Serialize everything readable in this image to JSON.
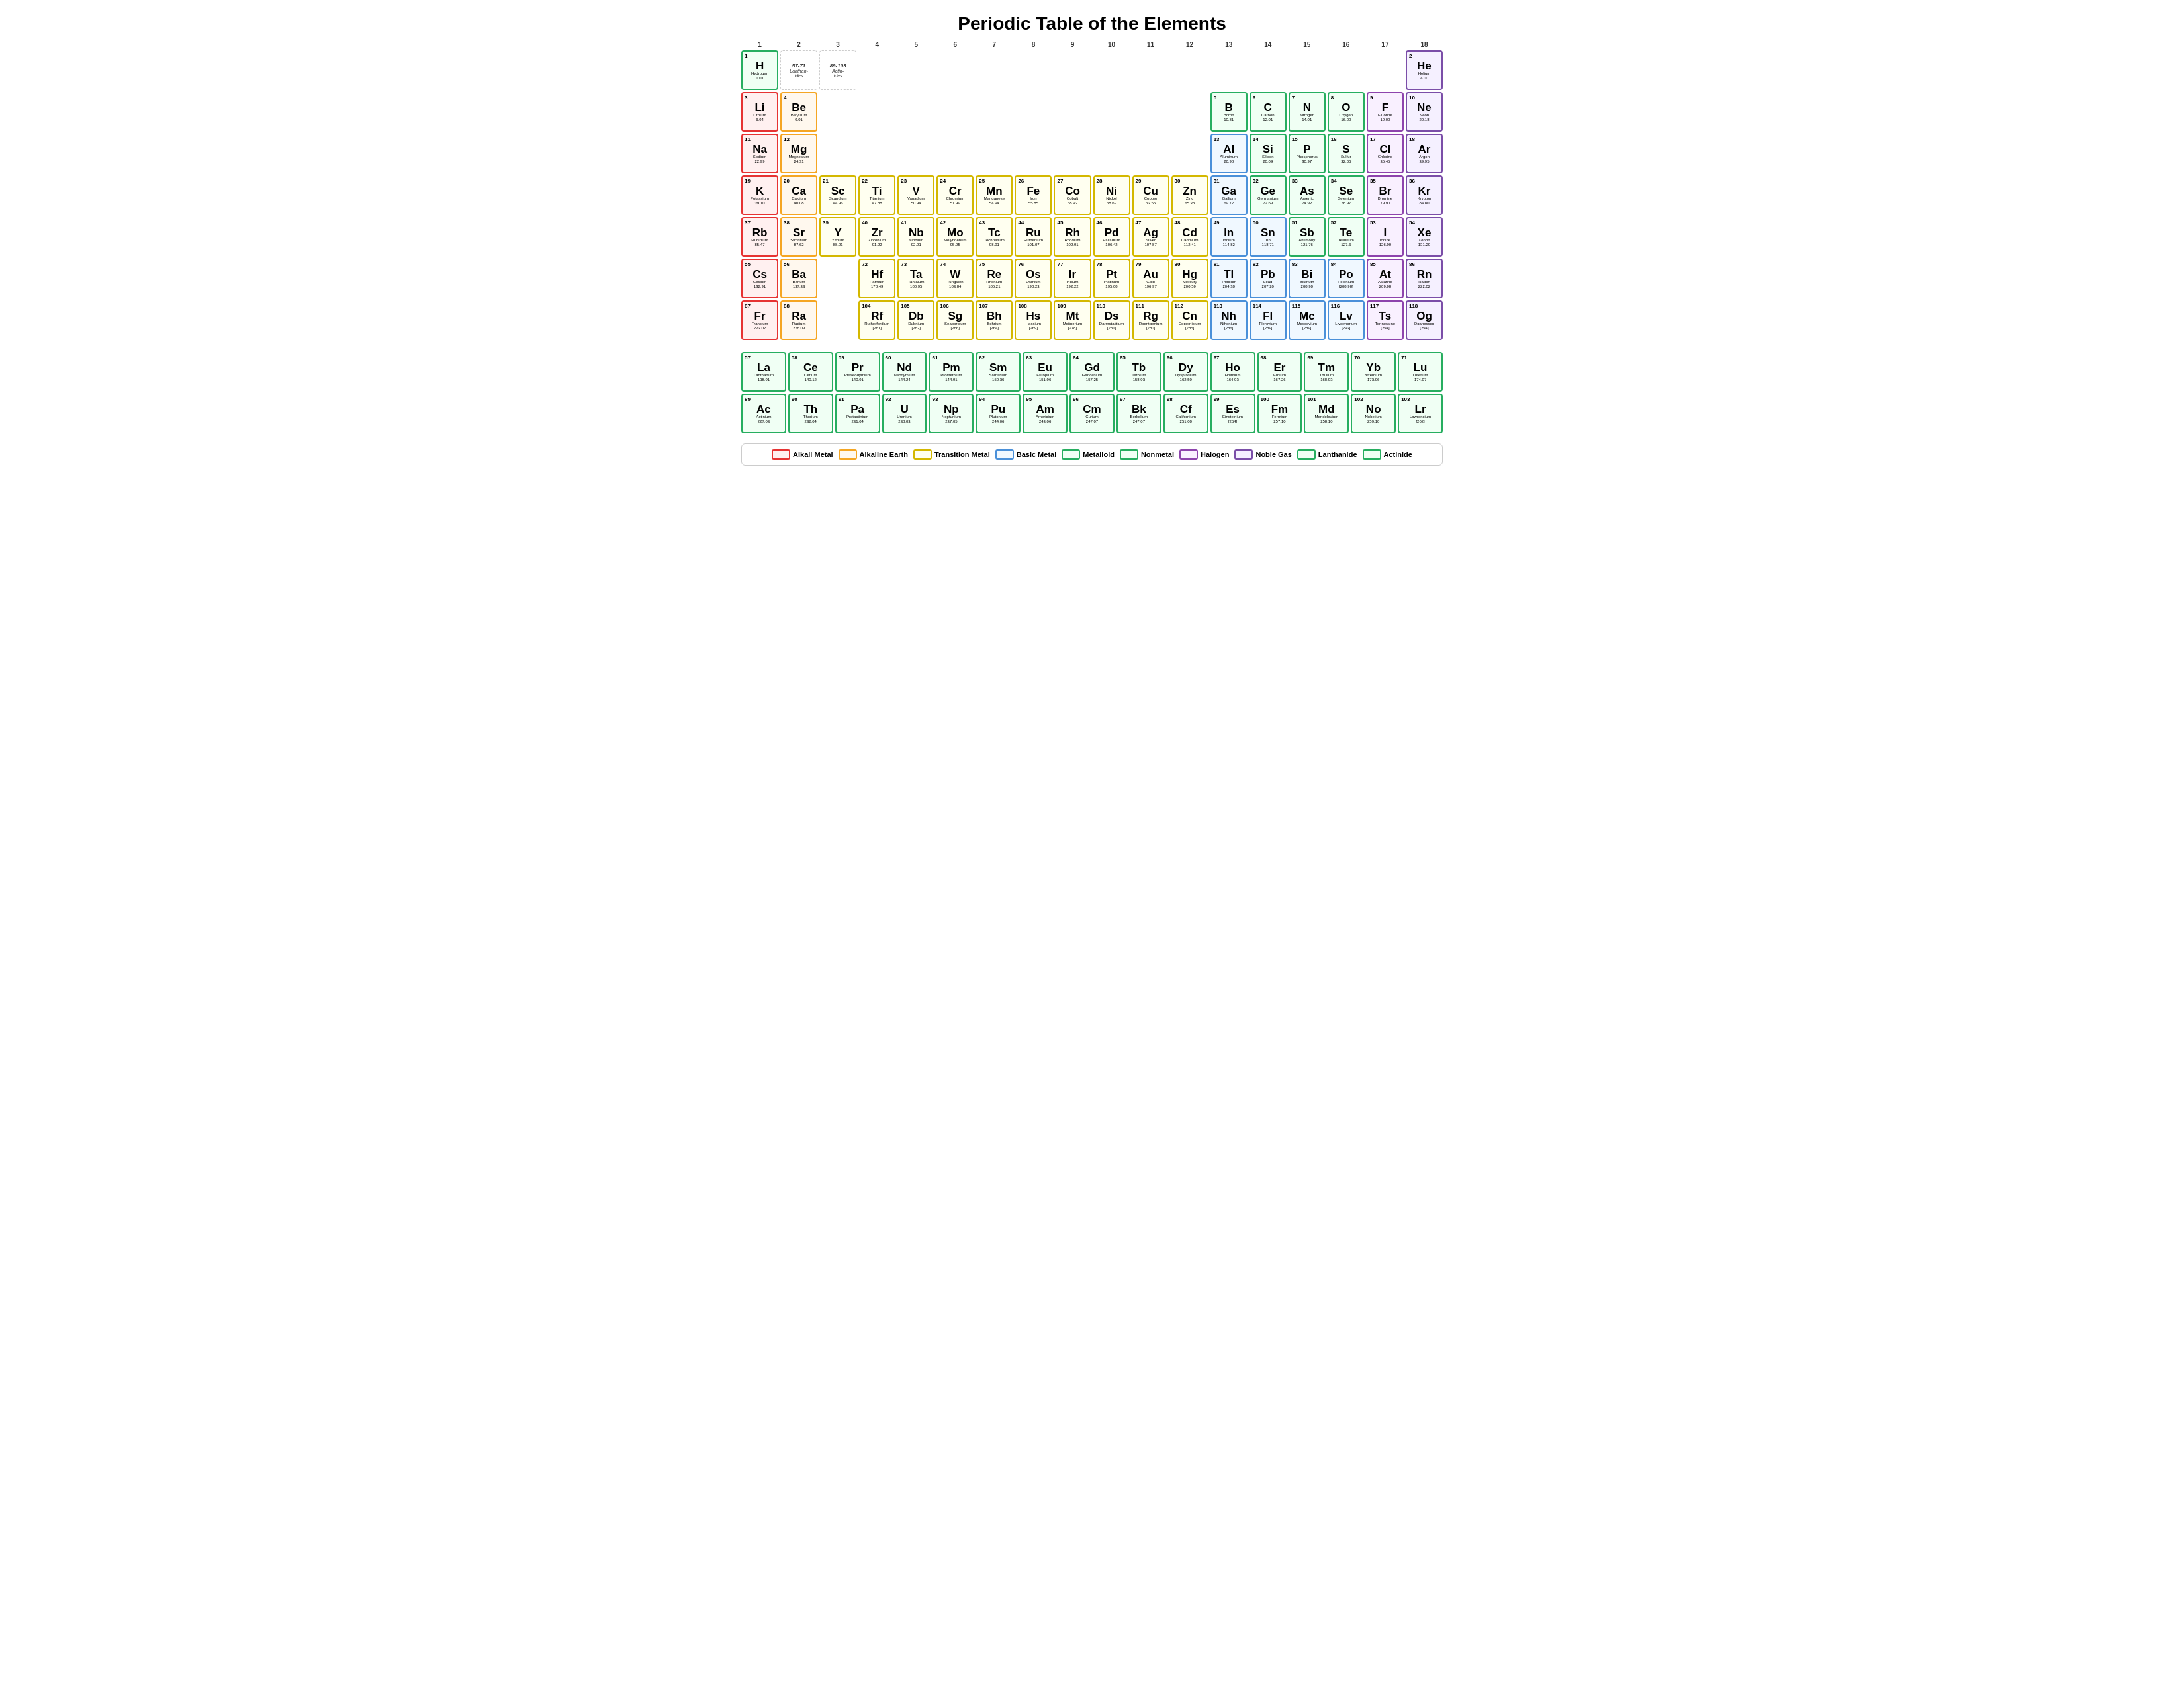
{
  "title": "Periodic Table of the Elements",
  "colHeaders": [
    1,
    2,
    3,
    4,
    5,
    6,
    7,
    8,
    9,
    10,
    11,
    12,
    13,
    14,
    15,
    16,
    17,
    18
  ],
  "legend": [
    {
      "label": "Alkali Metal",
      "class": "alkali",
      "borderColor": "#e63333",
      "bg": "#fff0f0"
    },
    {
      "label": "Alkaline Earth",
      "class": "alkaline",
      "borderColor": "#f5a623",
      "bg": "#fff8ee"
    },
    {
      "label": "Transition Metal",
      "class": "transition",
      "borderColor": "#e0b800",
      "bg": "#fffff0"
    },
    {
      "label": "Basic Metal",
      "class": "basic-metal",
      "borderColor": "#4a90d9",
      "bg": "#f0f8ff"
    },
    {
      "label": "Metalloid",
      "class": "metalloid",
      "borderColor": "#27ae60",
      "bg": "#f0fff4"
    },
    {
      "label": "Nonmetal",
      "class": "nonmetal",
      "borderColor": "#27ae60",
      "bg": "#f0fff4"
    },
    {
      "label": "Halogen",
      "class": "halogen",
      "borderColor": "#8e44ad",
      "bg": "#f9f0ff"
    },
    {
      "label": "Noble Gas",
      "class": "noble",
      "borderColor": "#7b4ea8",
      "bg": "#f5f0ff"
    },
    {
      "label": "Lanthanide",
      "class": "lanthanide",
      "borderColor": "#27ae60",
      "bg": "#f0fff4"
    },
    {
      "label": "Actinide",
      "class": "actinide",
      "borderColor": "#27ae60",
      "bg": "#f0fff4"
    }
  ],
  "elements": [
    {
      "num": 1,
      "sym": "H",
      "name": "Hydrogen",
      "mass": "1.01",
      "cat": "nonmetal",
      "col": 1,
      "row": 1
    },
    {
      "num": 2,
      "sym": "He",
      "name": "Helium",
      "mass": "4.00",
      "cat": "noble",
      "col": 18,
      "row": 1
    },
    {
      "num": 3,
      "sym": "Li",
      "name": "Lithium",
      "mass": "6.94",
      "cat": "alkali",
      "col": 1,
      "row": 2
    },
    {
      "num": 4,
      "sym": "Be",
      "name": "Beryllium",
      "mass": "9.01",
      "cat": "alkaline",
      "col": 2,
      "row": 2
    },
    {
      "num": 5,
      "sym": "B",
      "name": "Boron",
      "mass": "10.81",
      "cat": "metalloid",
      "col": 13,
      "row": 2
    },
    {
      "num": 6,
      "sym": "C",
      "name": "Carbon",
      "mass": "12.01",
      "cat": "nonmetal",
      "col": 14,
      "row": 2
    },
    {
      "num": 7,
      "sym": "N",
      "name": "Nitrogen",
      "mass": "14.01",
      "cat": "nonmetal",
      "col": 15,
      "row": 2
    },
    {
      "num": 8,
      "sym": "O",
      "name": "Oxygen",
      "mass": "16.00",
      "cat": "nonmetal",
      "col": 16,
      "row": 2
    },
    {
      "num": 9,
      "sym": "F",
      "name": "Fluorine",
      "mass": "19.00",
      "cat": "halogen",
      "col": 17,
      "row": 2
    },
    {
      "num": 10,
      "sym": "Ne",
      "name": "Neon",
      "mass": "20.18",
      "cat": "noble",
      "col": 18,
      "row": 2
    },
    {
      "num": 11,
      "sym": "Na",
      "name": "Sodium",
      "mass": "22.99",
      "cat": "alkali",
      "col": 1,
      "row": 3
    },
    {
      "num": 12,
      "sym": "Mg",
      "name": "Magnesium",
      "mass": "24.31",
      "cat": "alkaline",
      "col": 2,
      "row": 3
    },
    {
      "num": 13,
      "sym": "Al",
      "name": "Aluminum",
      "mass": "26.98",
      "cat": "basic-metal",
      "col": 13,
      "row": 3
    },
    {
      "num": 14,
      "sym": "Si",
      "name": "Silicon",
      "mass": "28.09",
      "cat": "metalloid",
      "col": 14,
      "row": 3
    },
    {
      "num": 15,
      "sym": "P",
      "name": "Phosphorus",
      "mass": "30.97",
      "cat": "nonmetal",
      "col": 15,
      "row": 3
    },
    {
      "num": 16,
      "sym": "S",
      "name": "Sulfur",
      "mass": "32.06",
      "cat": "nonmetal",
      "col": 16,
      "row": 3
    },
    {
      "num": 17,
      "sym": "Cl",
      "name": "Chlorine",
      "mass": "35.45",
      "cat": "halogen",
      "col": 17,
      "row": 3
    },
    {
      "num": 18,
      "sym": "Ar",
      "name": "Argon",
      "mass": "39.95",
      "cat": "noble",
      "col": 18,
      "row": 3
    },
    {
      "num": 19,
      "sym": "K",
      "name": "Potassium",
      "mass": "39.10",
      "cat": "alkali",
      "col": 1,
      "row": 4
    },
    {
      "num": 20,
      "sym": "Ca",
      "name": "Calcium",
      "mass": "40.08",
      "cat": "alkaline",
      "col": 2,
      "row": 4
    },
    {
      "num": 21,
      "sym": "Sc",
      "name": "Scandium",
      "mass": "44.96",
      "cat": "transition",
      "col": 3,
      "row": 4
    },
    {
      "num": 22,
      "sym": "Ti",
      "name": "Titanium",
      "mass": "47.88",
      "cat": "transition",
      "col": 4,
      "row": 4
    },
    {
      "num": 23,
      "sym": "V",
      "name": "Vanadium",
      "mass": "50.94",
      "cat": "transition",
      "col": 5,
      "row": 4
    },
    {
      "num": 24,
      "sym": "Cr",
      "name": "Chromium",
      "mass": "51.99",
      "cat": "transition",
      "col": 6,
      "row": 4
    },
    {
      "num": 25,
      "sym": "Mn",
      "name": "Manganese",
      "mass": "54.94",
      "cat": "transition",
      "col": 7,
      "row": 4
    },
    {
      "num": 26,
      "sym": "Fe",
      "name": "Iron",
      "mass": "55.85",
      "cat": "transition",
      "col": 8,
      "row": 4
    },
    {
      "num": 27,
      "sym": "Co",
      "name": "Cobalt",
      "mass": "58.93",
      "cat": "transition",
      "col": 9,
      "row": 4
    },
    {
      "num": 28,
      "sym": "Ni",
      "name": "Nickel",
      "mass": "58.69",
      "cat": "transition",
      "col": 10,
      "row": 4
    },
    {
      "num": 29,
      "sym": "Cu",
      "name": "Copper",
      "mass": "63.55",
      "cat": "transition",
      "col": 11,
      "row": 4
    },
    {
      "num": 30,
      "sym": "Zn",
      "name": "Zinc",
      "mass": "65.38",
      "cat": "transition",
      "col": 12,
      "row": 4
    },
    {
      "num": 31,
      "sym": "Ga",
      "name": "Gallium",
      "mass": "69.72",
      "cat": "basic-metal",
      "col": 13,
      "row": 4
    },
    {
      "num": 32,
      "sym": "Ge",
      "name": "Germanium",
      "mass": "72.63",
      "cat": "metalloid",
      "col": 14,
      "row": 4
    },
    {
      "num": 33,
      "sym": "As",
      "name": "Arsenic",
      "mass": "74.92",
      "cat": "metalloid",
      "col": 15,
      "row": 4
    },
    {
      "num": 34,
      "sym": "Se",
      "name": "Selenium",
      "mass": "78.97",
      "cat": "nonmetal",
      "col": 16,
      "row": 4
    },
    {
      "num": 35,
      "sym": "Br",
      "name": "Bromine",
      "mass": "79.90",
      "cat": "halogen",
      "col": 17,
      "row": 4
    },
    {
      "num": 36,
      "sym": "Kr",
      "name": "Krypton",
      "mass": "84.80",
      "cat": "noble",
      "col": 18,
      "row": 4
    },
    {
      "num": 37,
      "sym": "Rb",
      "name": "Rubidium",
      "mass": "85.47",
      "cat": "alkali",
      "col": 1,
      "row": 5
    },
    {
      "num": 38,
      "sym": "Sr",
      "name": "Strontium",
      "mass": "87.62",
      "cat": "alkaline",
      "col": 2,
      "row": 5
    },
    {
      "num": 39,
      "sym": "Y",
      "name": "Yttrium",
      "mass": "88.91",
      "cat": "transition",
      "col": 3,
      "row": 5
    },
    {
      "num": 40,
      "sym": "Zr",
      "name": "Zirconium",
      "mass": "91.22",
      "cat": "transition",
      "col": 4,
      "row": 5
    },
    {
      "num": 41,
      "sym": "Nb",
      "name": "Niobium",
      "mass": "92.91",
      "cat": "transition",
      "col": 5,
      "row": 5
    },
    {
      "num": 42,
      "sym": "Mo",
      "name": "Molybdenum",
      "mass": "95.95",
      "cat": "transition",
      "col": 6,
      "row": 5
    },
    {
      "num": 43,
      "sym": "Tc",
      "name": "Technetium",
      "mass": "98.91",
      "cat": "transition",
      "col": 7,
      "row": 5
    },
    {
      "num": 44,
      "sym": "Ru",
      "name": "Ruthenium",
      "mass": "101.07",
      "cat": "transition",
      "col": 8,
      "row": 5
    },
    {
      "num": 45,
      "sym": "Rh",
      "name": "Rhodium",
      "mass": "102.91",
      "cat": "transition",
      "col": 9,
      "row": 5
    },
    {
      "num": 46,
      "sym": "Pd",
      "name": "Palladium",
      "mass": "106.42",
      "cat": "transition",
      "col": 10,
      "row": 5
    },
    {
      "num": 47,
      "sym": "Ag",
      "name": "Silver",
      "mass": "107.87",
      "cat": "transition",
      "col": 11,
      "row": 5
    },
    {
      "num": 48,
      "sym": "Cd",
      "name": "Cadmium",
      "mass": "112.41",
      "cat": "transition",
      "col": 12,
      "row": 5
    },
    {
      "num": 49,
      "sym": "In",
      "name": "Indium",
      "mass": "114.82",
      "cat": "basic-metal",
      "col": 13,
      "row": 5
    },
    {
      "num": 50,
      "sym": "Sn",
      "name": "Tin",
      "mass": "118.71",
      "cat": "basic-metal",
      "col": 14,
      "row": 5
    },
    {
      "num": 51,
      "sym": "Sb",
      "name": "Antimony",
      "mass": "121.76",
      "cat": "metalloid",
      "col": 15,
      "row": 5
    },
    {
      "num": 52,
      "sym": "Te",
      "name": "Tellurium",
      "mass": "127.6",
      "cat": "metalloid",
      "col": 16,
      "row": 5
    },
    {
      "num": 53,
      "sym": "I",
      "name": "Iodine",
      "mass": "126.90",
      "cat": "halogen",
      "col": 17,
      "row": 5
    },
    {
      "num": 54,
      "sym": "Xe",
      "name": "Xenon",
      "mass": "131.29",
      "cat": "noble",
      "col": 18,
      "row": 5
    },
    {
      "num": 55,
      "sym": "Cs",
      "name": "Cesium",
      "mass": "132.91",
      "cat": "alkali",
      "col": 1,
      "row": 6
    },
    {
      "num": 56,
      "sym": "Ba",
      "name": "Barium",
      "mass": "137.33",
      "cat": "alkaline",
      "col": 2,
      "row": 6
    },
    {
      "num": 72,
      "sym": "Hf",
      "name": "Hafnium",
      "mass": "178.49",
      "cat": "transition",
      "col": 4,
      "row": 6
    },
    {
      "num": 73,
      "sym": "Ta",
      "name": "Tantalum",
      "mass": "180.95",
      "cat": "transition",
      "col": 5,
      "row": 6
    },
    {
      "num": 74,
      "sym": "W",
      "name": "Tungsten",
      "mass": "183.84",
      "cat": "transition",
      "col": 6,
      "row": 6
    },
    {
      "num": 75,
      "sym": "Re",
      "name": "Rhenium",
      "mass": "186.21",
      "cat": "transition",
      "col": 7,
      "row": 6
    },
    {
      "num": 76,
      "sym": "Os",
      "name": "Osmium",
      "mass": "190.23",
      "cat": "transition",
      "col": 8,
      "row": 6
    },
    {
      "num": 77,
      "sym": "Ir",
      "name": "Iridium",
      "mass": "192.22",
      "cat": "transition",
      "col": 9,
      "row": 6
    },
    {
      "num": 78,
      "sym": "Pt",
      "name": "Platinum",
      "mass": "195.08",
      "cat": "transition",
      "col": 10,
      "row": 6
    },
    {
      "num": 79,
      "sym": "Au",
      "name": "Gold",
      "mass": "196.97",
      "cat": "transition",
      "col": 11,
      "row": 6
    },
    {
      "num": 80,
      "sym": "Hg",
      "name": "Mercury",
      "mass": "200.59",
      "cat": "transition",
      "col": 12,
      "row": 6
    },
    {
      "num": 81,
      "sym": "Tl",
      "name": "Thallium",
      "mass": "204.38",
      "cat": "basic-metal",
      "col": 13,
      "row": 6
    },
    {
      "num": 82,
      "sym": "Pb",
      "name": "Lead",
      "mass": "207.20",
      "cat": "basic-metal",
      "col": 14,
      "row": 6
    },
    {
      "num": 83,
      "sym": "Bi",
      "name": "Bismuth",
      "mass": "208.98",
      "cat": "basic-metal",
      "col": 15,
      "row": 6
    },
    {
      "num": 84,
      "sym": "Po",
      "name": "Polonium",
      "mass": "[208.98]",
      "cat": "basic-metal",
      "col": 16,
      "row": 6
    },
    {
      "num": 85,
      "sym": "At",
      "name": "Astatine",
      "mass": "209.98",
      "cat": "halogen",
      "col": 17,
      "row": 6
    },
    {
      "num": 86,
      "sym": "Rn",
      "name": "Radon",
      "mass": "222.02",
      "cat": "noble",
      "col": 18,
      "row": 6
    },
    {
      "num": 87,
      "sym": "Fr",
      "name": "Francium",
      "mass": "223.02",
      "cat": "alkali",
      "col": 1,
      "row": 7
    },
    {
      "num": 88,
      "sym": "Ra",
      "name": "Radium",
      "mass": "226.03",
      "cat": "alkaline",
      "col": 2,
      "row": 7
    },
    {
      "num": 104,
      "sym": "Rf",
      "name": "Rutherfordium",
      "mass": "[261]",
      "cat": "transition",
      "col": 4,
      "row": 7
    },
    {
      "num": 105,
      "sym": "Db",
      "name": "Dubnium",
      "mass": "[262]",
      "cat": "transition",
      "col": 5,
      "row": 7
    },
    {
      "num": 106,
      "sym": "Sg",
      "name": "Seaborgium",
      "mass": "[266]",
      "cat": "transition",
      "col": 6,
      "row": 7
    },
    {
      "num": 107,
      "sym": "Bh",
      "name": "Bohrium",
      "mass": "[264]",
      "cat": "transition",
      "col": 7,
      "row": 7
    },
    {
      "num": 108,
      "sym": "Hs",
      "name": "Hassium",
      "mass": "[269]",
      "cat": "transition",
      "col": 8,
      "row": 7
    },
    {
      "num": 109,
      "sym": "Mt",
      "name": "Meitnerium",
      "mass": "[278]",
      "cat": "transition",
      "col": 9,
      "row": 7
    },
    {
      "num": 110,
      "sym": "Ds",
      "name": "Darmstadtium",
      "mass": "[281]",
      "cat": "transition",
      "col": 10,
      "row": 7
    },
    {
      "num": 111,
      "sym": "Rg",
      "name": "Roentgenium",
      "mass": "[280]",
      "cat": "transition",
      "col": 11,
      "row": 7
    },
    {
      "num": 112,
      "sym": "Cn",
      "name": "Copernicium",
      "mass": "[285]",
      "cat": "transition",
      "col": 12,
      "row": 7
    },
    {
      "num": 113,
      "sym": "Nh",
      "name": "Nihonium",
      "mass": "[286]",
      "cat": "basic-metal",
      "col": 13,
      "row": 7
    },
    {
      "num": 114,
      "sym": "Fl",
      "name": "Flerovium",
      "mass": "[289]",
      "cat": "basic-metal",
      "col": 14,
      "row": 7
    },
    {
      "num": 115,
      "sym": "Mc",
      "name": "Moscovium",
      "mass": "[289]",
      "cat": "basic-metal",
      "col": 15,
      "row": 7
    },
    {
      "num": 116,
      "sym": "Lv",
      "name": "Livermorium",
      "mass": "[293]",
      "cat": "basic-metal",
      "col": 16,
      "row": 7
    },
    {
      "num": 117,
      "sym": "Ts",
      "name": "Tennessine",
      "mass": "[294]",
      "cat": "halogen",
      "col": 17,
      "row": 7
    },
    {
      "num": 118,
      "sym": "Og",
      "name": "Oganesson",
      "mass": "[294]",
      "cat": "noble",
      "col": 18,
      "row": 7
    }
  ],
  "lanthanides": [
    {
      "num": 57,
      "sym": "La",
      "name": "Lanthanum",
      "mass": "138.91"
    },
    {
      "num": 58,
      "sym": "Ce",
      "name": "Cerium",
      "mass": "140.12"
    },
    {
      "num": 59,
      "sym": "Pr",
      "name": "Praseodymium",
      "mass": "140.91"
    },
    {
      "num": 60,
      "sym": "Nd",
      "name": "Neodymium",
      "mass": "144.24"
    },
    {
      "num": 61,
      "sym": "Pm",
      "name": "Promethium",
      "mass": "144.91"
    },
    {
      "num": 62,
      "sym": "Sm",
      "name": "Samarium",
      "mass": "150.36"
    },
    {
      "num": 63,
      "sym": "Eu",
      "name": "Europium",
      "mass": "151.96"
    },
    {
      "num": 64,
      "sym": "Gd",
      "name": "Gadolinium",
      "mass": "157.25"
    },
    {
      "num": 65,
      "sym": "Tb",
      "name": "Terbium",
      "mass": "158.93"
    },
    {
      "num": 66,
      "sym": "Dy",
      "name": "Dysprosium",
      "mass": "162.50"
    },
    {
      "num": 67,
      "sym": "Ho",
      "name": "Holmium",
      "mass": "164.93"
    },
    {
      "num": 68,
      "sym": "Er",
      "name": "Erbium",
      "mass": "167.26"
    },
    {
      "num": 69,
      "sym": "Tm",
      "name": "Thulium",
      "mass": "168.93"
    },
    {
      "num": 70,
      "sym": "Yb",
      "name": "Ytterbium",
      "mass": "173.06"
    },
    {
      "num": 71,
      "sym": "Lu",
      "name": "Lutetium",
      "mass": "174.97"
    }
  ],
  "actinides": [
    {
      "num": 89,
      "sym": "Ac",
      "name": "Actinium",
      "mass": "227.03"
    },
    {
      "num": 90,
      "sym": "Th",
      "name": "Thorium",
      "mass": "232.04"
    },
    {
      "num": 91,
      "sym": "Pa",
      "name": "Protactinium",
      "mass": "231.04"
    },
    {
      "num": 92,
      "sym": "U",
      "name": "Uranium",
      "mass": "238.03"
    },
    {
      "num": 93,
      "sym": "Np",
      "name": "Neptunium",
      "mass": "237.05"
    },
    {
      "num": 94,
      "sym": "Pu",
      "name": "Plutonium",
      "mass": "244.06"
    },
    {
      "num": 95,
      "sym": "Am",
      "name": "Americium",
      "mass": "243.06"
    },
    {
      "num": 96,
      "sym": "Cm",
      "name": "Curium",
      "mass": "247.07"
    },
    {
      "num": 97,
      "sym": "Bk",
      "name": "Berkelium",
      "mass": "247.07"
    },
    {
      "num": 98,
      "sym": "Cf",
      "name": "Californium",
      "mass": "251.08"
    },
    {
      "num": 99,
      "sym": "Es",
      "name": "Einsteinium",
      "mass": "[254]"
    },
    {
      "num": 100,
      "sym": "Fm",
      "name": "Fermium",
      "mass": "257.10"
    },
    {
      "num": 101,
      "sym": "Md",
      "name": "Mendelevium",
      "mass": "258.10"
    },
    {
      "num": 102,
      "sym": "No",
      "name": "Nobelium",
      "mass": "259.10"
    },
    {
      "num": 103,
      "sym": "Lr",
      "name": "Lawrencium",
      "mass": "[262]"
    }
  ],
  "specialLabels": {
    "lanthanides": "57-71\nLanthanides",
    "actinides": "89-103\nActinides"
  }
}
